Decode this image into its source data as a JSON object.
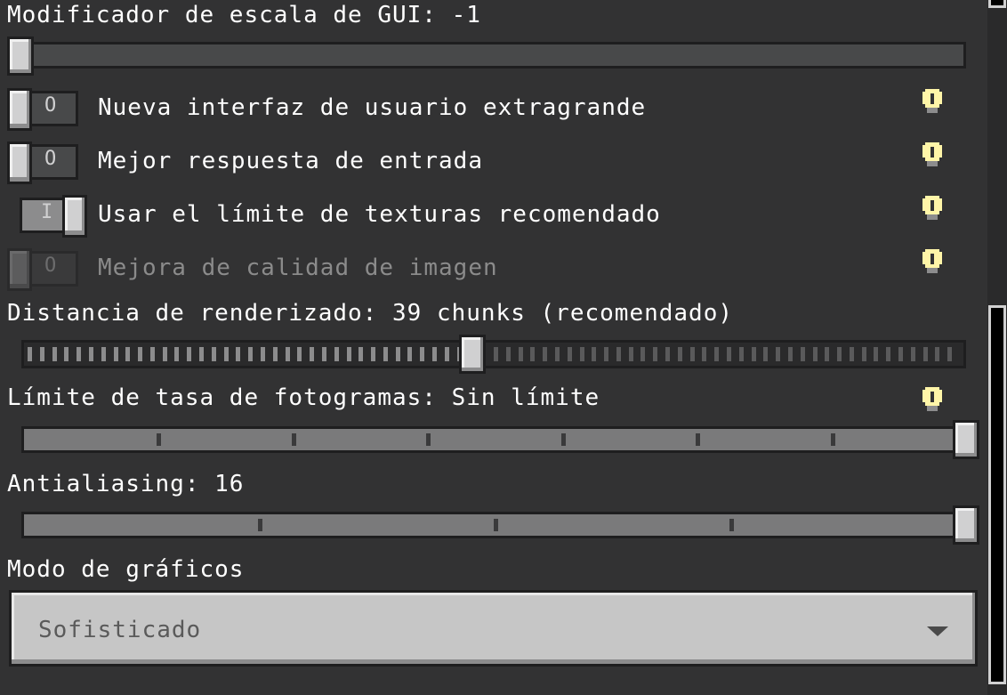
{
  "gui_scale": {
    "label": "Modificador de escala de GUI: -1",
    "value_fraction": 0.0
  },
  "toggles": [
    {
      "label": "Nueva interfaz de usuario extragrande",
      "state": "off",
      "glyph": "O",
      "enabled": true,
      "has_info": true
    },
    {
      "label": "Mejor respuesta de entrada",
      "state": "off",
      "glyph": "O",
      "enabled": true,
      "has_info": true
    },
    {
      "label": "Usar el límite de texturas recomendado",
      "state": "on",
      "glyph": "I",
      "enabled": true,
      "has_info": true
    },
    {
      "label": "Mejora de calidad de imagen",
      "state": "off",
      "glyph": "O",
      "enabled": false,
      "has_info": true
    }
  ],
  "render_distance": {
    "label": "Distancia de renderizado: 39 chunks (recomendado)",
    "value_fraction": 0.48
  },
  "framerate_limit": {
    "label": "Límite de tasa de fotogramas: Sin límite",
    "value_fraction": 1.0,
    "steps": 7,
    "has_info": true
  },
  "antialiasing": {
    "label": "Antialiasing: 16",
    "value_fraction": 1.0,
    "steps": 4
  },
  "graphics_mode": {
    "label": "Modo de gráficos",
    "selected": "Sofisticado"
  },
  "icons": {
    "info": "lightbulb-info-icon",
    "dropdown": "triangle-down-icon"
  },
  "colors": {
    "background": "#323233",
    "info_bulb": "#fff5a8",
    "disabled_text": "#8b8b8b"
  }
}
